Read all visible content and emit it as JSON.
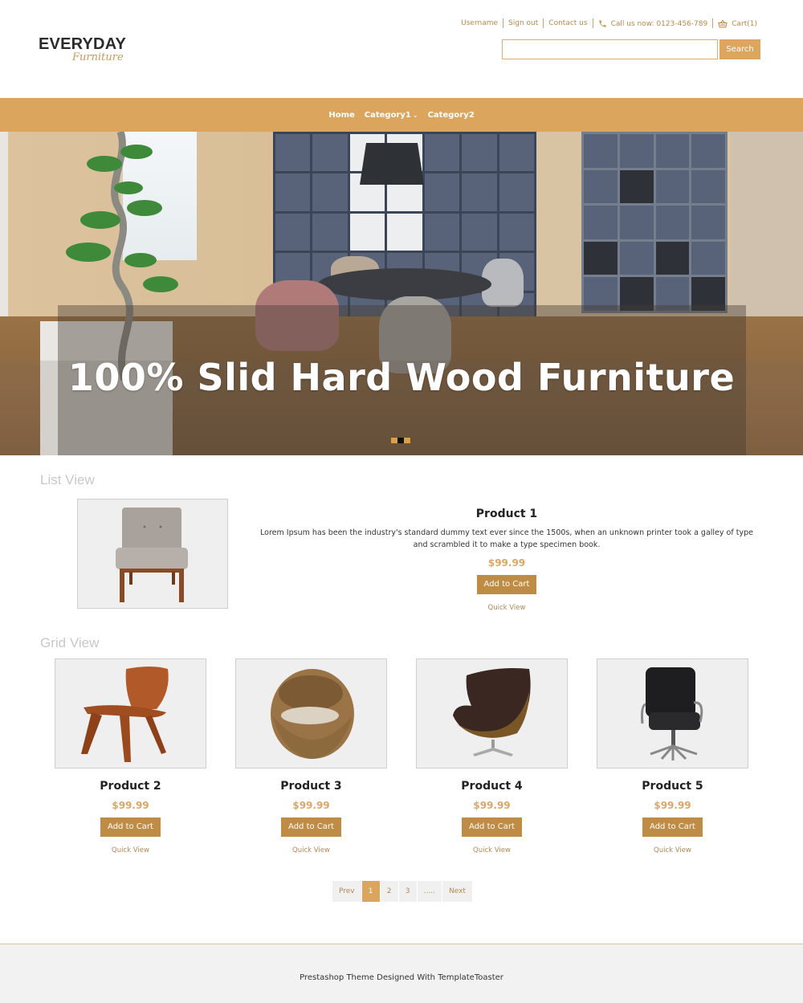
{
  "header": {
    "logo": {
      "main": "EVERYDAY",
      "sub": "Furniture"
    },
    "top_links": {
      "username": "Username",
      "sign_out": "Sign out",
      "contact": "Contact us",
      "phone": "Call us now: 0123-456-789",
      "cart": "Cart(1)"
    },
    "search": {
      "value": "",
      "placeholder": "",
      "button": "Search"
    }
  },
  "nav": {
    "items": [
      {
        "label": "Home",
        "has_dropdown": false
      },
      {
        "label": "Category1",
        "has_dropdown": true
      },
      {
        "label": "Category2",
        "has_dropdown": false
      }
    ]
  },
  "hero": {
    "title": "100% Slid Hard Wood Furniture",
    "slides": 3,
    "active_slide": 2
  },
  "list_view": {
    "heading": "List View",
    "product": {
      "name": "Product 1",
      "description": "Lorem Ipsum has been the industry's standard dummy text ever since the 1500s, when an unknown printer took a galley of type and scrambled it to make a type specimen book.",
      "price": "$99.99",
      "add_to_cart": "Add to Cart",
      "quick_view": "Quick View",
      "image": "upholstered-armless-chair"
    }
  },
  "grid_view": {
    "heading": "Grid View",
    "products": [
      {
        "name": "Product 2",
        "price": "$99.99",
        "add_to_cart": "Add to Cart",
        "quick_view": "Quick View",
        "image": "molded-wood-lounge-chair"
      },
      {
        "name": "Product 3",
        "price": "$99.99",
        "add_to_cart": "Add to Cart",
        "quick_view": "Quick View",
        "image": "wicker-egg-chair"
      },
      {
        "name": "Product 4",
        "price": "$99.99",
        "add_to_cart": "Add to Cart",
        "quick_view": "Quick View",
        "image": "leather-egg-chair"
      },
      {
        "name": "Product 5",
        "price": "$99.99",
        "add_to_cart": "Add to Cart",
        "quick_view": "Quick View",
        "image": "office-chair"
      }
    ]
  },
  "pagination": {
    "prev": "Prev",
    "pages": [
      "1",
      "2",
      "3",
      "....."
    ],
    "active": "1",
    "next": "Next"
  },
  "footer": {
    "text": "Prestashop Theme Designed With TemplateToaster"
  },
  "colors": {
    "accent": "#dba55e",
    "button": "#bf8c45",
    "price": "#d9a768",
    "link": "#b8894a"
  }
}
